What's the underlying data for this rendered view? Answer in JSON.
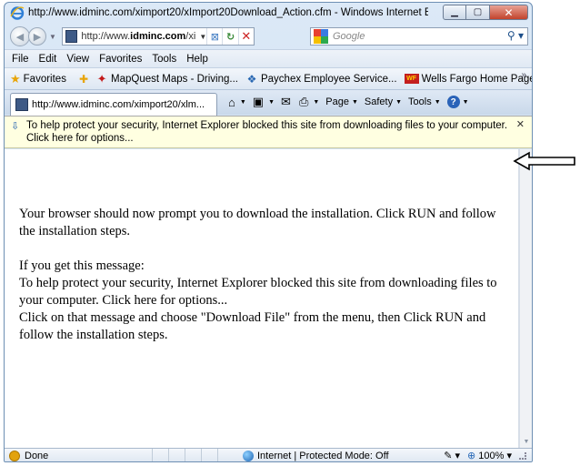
{
  "window": {
    "title": "http://www.idminc.com/ximport20/xImport20Download_Action.cfm - Windows Internet Explorer"
  },
  "address_bar": {
    "url_prefix": "http://www.",
    "url_domain": "idminc.com",
    "url_suffix": "/ximp"
  },
  "search": {
    "placeholder": "Google"
  },
  "menu": {
    "items": [
      "File",
      "Edit",
      "View",
      "Favorites",
      "Tools",
      "Help"
    ]
  },
  "favorites_bar": {
    "label": "Favorites",
    "links": [
      {
        "label": "MapQuest Maps - Driving...",
        "icon": "mapquest-icon"
      },
      {
        "label": "Paychex Employee Service...",
        "icon": "paychex-icon"
      },
      {
        "label": "Wells Fargo Home Page",
        "icon": "wellsfargo-icon",
        "badge": "WF"
      }
    ]
  },
  "tab": {
    "label": "http://www.idminc.com/ximport20/xlm..."
  },
  "command_bar": {
    "page": "Page",
    "safety": "Safety",
    "tools": "Tools"
  },
  "info_bar": {
    "text": "To help protect your security, Internet Explorer blocked this site from downloading files to your computer. Click here for options..."
  },
  "content": {
    "paragraph1": "Your browser should now prompt you to download the installation. Click RUN and follow the installation steps.",
    "line_if": "If you get this message:",
    "line_msg": "To help protect your security, Internet Explorer blocked this site from downloading files to your computer. Click here for options...",
    "line_click": "Click on that message and choose \"Download File\" from the menu, then Click RUN and follow the installation steps."
  },
  "status_bar": {
    "status": "Done",
    "zone": "Internet | Protected Mode: Off",
    "zoom": "100%"
  },
  "colors": {
    "infobar_bg": "#ffffe1",
    "close_button": "#c2432b",
    "chrome": "#c6d8ee"
  }
}
